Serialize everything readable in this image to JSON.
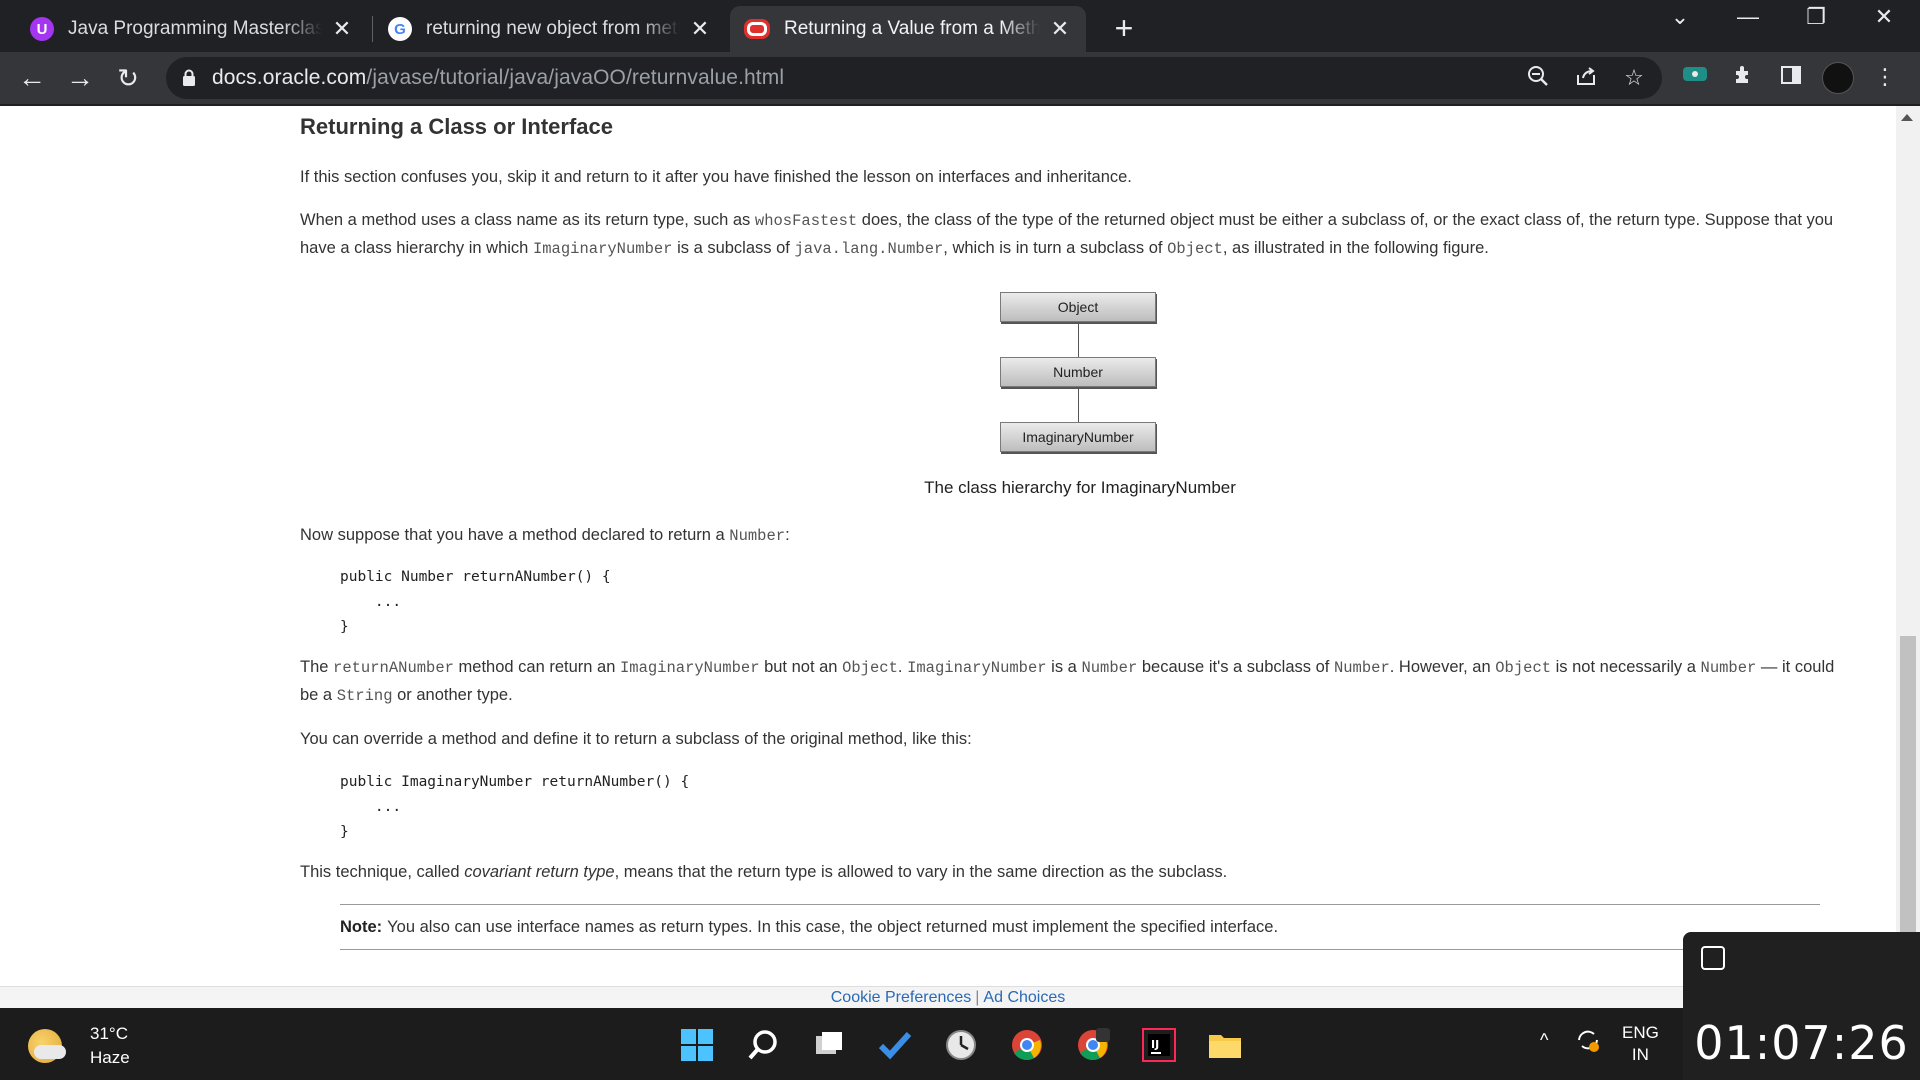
{
  "browser": {
    "tabs": [
      {
        "title": "Java Programming Masterclass co",
        "active": false
      },
      {
        "title": "returning new object from metho",
        "active": false
      },
      {
        "title": "Returning a Value from a Method",
        "active": true
      }
    ],
    "url_host": "docs.oracle.com",
    "url_path": "/javase/tutorial/java/javaOO/returnvalue.html"
  },
  "page": {
    "heading": "Returning a Class or Interface",
    "p1": "If this section confuses you, skip it and return to it after you have finished the lesson on interfaces and inheritance.",
    "p2": {
      "a": "When a method uses a class name as its return type, such as ",
      "code1": "whosFastest",
      "b": " does, the class of the type of the returned object must be either a subclass of, or the exact class of, the return type. Suppose that you have a class hierarchy in which ",
      "code2": "ImaginaryNumber",
      "c": " is a subclass of ",
      "code3": "java.lang.Number",
      "d": ", which is in turn a subclass of ",
      "code4": "Object",
      "e": ", as illustrated in the following figure."
    },
    "figure": {
      "nodes": [
        "Object",
        "Number",
        "ImaginaryNumber"
      ],
      "caption": "The class hierarchy for ImaginaryNumber"
    },
    "p3": {
      "a": "Now suppose that you have a method declared to return a ",
      "code": "Number",
      "b": ":"
    },
    "code_block_1": [
      "public Number returnANumber() {",
      "    ...",
      "}"
    ],
    "p4": {
      "code1": "returnANumber",
      "a": " method can return an ",
      "code2": "ImaginaryNumber",
      "b": " but not an ",
      "code3": "Object",
      "c": ". ",
      "code4": "ImaginaryNumber",
      "d": " is a ",
      "code5": "Number",
      "e": " because it's a subclass of ",
      "code6": "Number",
      "f": ". However, an ",
      "code7": "Object",
      "g": " is not necessarily a ",
      "code8": "Number",
      "h": " — it could be a ",
      "code9": "String",
      "i": " or another type.",
      "lead": "The "
    },
    "p5": "You can override a method and define it to return a subclass of the original method, like this:",
    "code_block_2": [
      "public ImaginaryNumber returnANumber() {",
      "    ...",
      "}"
    ],
    "p6": {
      "a": "This technique, called ",
      "em": "covariant return type",
      "b": ", means that the return type is allowed to vary in the same direction as the subclass."
    },
    "note": {
      "label": "Note:",
      "text": "You also can use interface names as return types. In this case, the object returned must implement the specified interface."
    },
    "footer": {
      "cookie": "Cookie Preferences",
      "sep": "|",
      "ad": "Ad Choices"
    }
  },
  "taskbar": {
    "weather_temp": "31°C",
    "weather_desc": "Haze",
    "lang_1": "ENG",
    "lang_2": "IN",
    "clock": "01:07:26"
  },
  "colors": {
    "tab_bg": "#202124",
    "toolbar_bg": "#35363a",
    "link": "#2a6ab4",
    "oracle_red": "#e0302b"
  }
}
